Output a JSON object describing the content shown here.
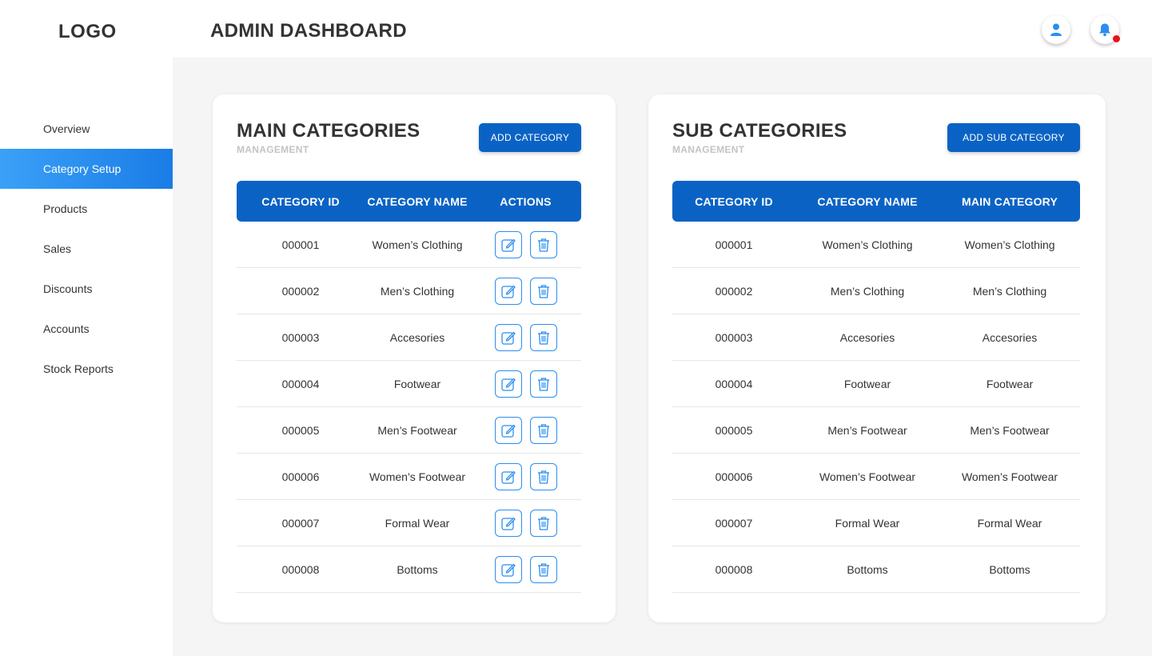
{
  "header": {
    "logo": "LOGO",
    "title": "ADMIN DASHBOARD"
  },
  "sidebar": {
    "items": [
      {
        "label": "Overview",
        "active": false
      },
      {
        "label": "Category Setup",
        "active": true
      },
      {
        "label": "Products",
        "active": false
      },
      {
        "label": "Sales",
        "active": false
      },
      {
        "label": "Discounts",
        "active": false
      },
      {
        "label": "Accounts",
        "active": false
      },
      {
        "label": "Stock Reports",
        "active": false
      }
    ]
  },
  "main_categories": {
    "title": "MAIN CATEGORIES",
    "subtitle": "MANAGEMENT",
    "add_button": "ADD CATEGORY",
    "columns": [
      "CATEGORY ID",
      "CATEGORY NAME",
      "ACTIONS"
    ],
    "rows": [
      {
        "id": "000001",
        "name": "Women’s Clothing"
      },
      {
        "id": "000002",
        "name": "Men’s Clothing"
      },
      {
        "id": "000003",
        "name": "Accesories"
      },
      {
        "id": "000004",
        "name": "Footwear"
      },
      {
        "id": "000005",
        "name": "Men’s Footwear"
      },
      {
        "id": "000006",
        "name": "Women’s Footwear"
      },
      {
        "id": "000007",
        "name": "Formal Wear"
      },
      {
        "id": "000008",
        "name": "Bottoms"
      }
    ]
  },
  "sub_categories": {
    "title": "SUB CATEGORIES",
    "subtitle": "MANAGEMENT",
    "add_button": "ADD SUB CATEGORY",
    "columns": [
      "CATEGORY ID",
      "CATEGORY NAME",
      "MAIN CATEGORY"
    ],
    "rows": [
      {
        "id": "000001",
        "name": "Women’s Clothing",
        "main": "Women’s Clothing"
      },
      {
        "id": "000002",
        "name": "Men’s Clothing",
        "main": "Men’s Clothing"
      },
      {
        "id": "000003",
        "name": "Accesories",
        "main": "Accesories"
      },
      {
        "id": "000004",
        "name": "Footwear",
        "main": "Footwear"
      },
      {
        "id": "000005",
        "name": "Men’s Footwear",
        "main": "Men’s Footwear"
      },
      {
        "id": "000006",
        "name": "Women’s Footwear",
        "main": "Women’s Footwear"
      },
      {
        "id": "000007",
        "name": "Formal Wear",
        "main": "Formal Wear"
      },
      {
        "id": "000008",
        "name": "Bottoms",
        "main": "Bottoms"
      }
    ]
  },
  "icons": {
    "user": "user-icon",
    "bell": "bell-icon",
    "edit": "edit-icon",
    "delete": "trash-icon"
  },
  "colors": {
    "accent": "#0a63c4",
    "sidebar_active_start": "#3aa1f7",
    "sidebar_active_end": "#1a7ce6",
    "icon_blue": "#2b8ef0",
    "notification": "#e8141b",
    "background": "#f5f5f5"
  }
}
